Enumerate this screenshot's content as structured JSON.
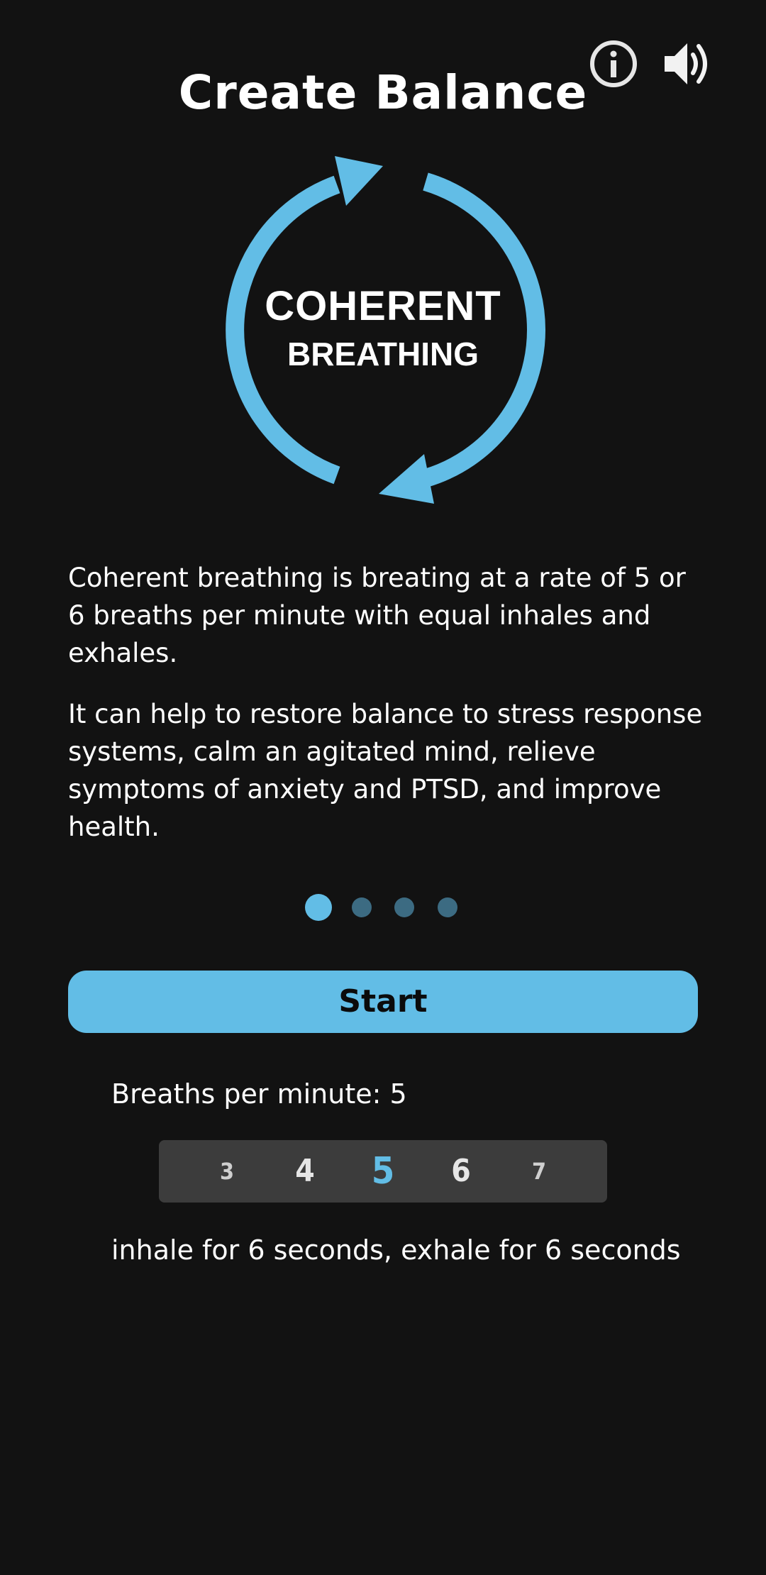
{
  "header": {
    "title": "Create Balance",
    "info_icon": "info-icon",
    "sound_icon": "speaker-volume-icon"
  },
  "logo": {
    "line1": "COHERENT",
    "line2": "BREATHING",
    "arrow_color": "#62bde6",
    "icon": "circular-arrows-icon"
  },
  "description": {
    "paragraph1": "Coherent breathing is breating at a rate of 5 or 6 breaths per minute with equal inhales and exhales.",
    "paragraph2": "It can help to restore balance to stress response systems, calm an agitated mind, relieve symptoms of anxiety and PTSD, and improve health."
  },
  "pager": {
    "total": 4,
    "active_index": 0
  },
  "start_button": {
    "label": "Start"
  },
  "breaths": {
    "label": "Breaths per minute: 5",
    "options": [
      "3",
      "4",
      "5",
      "6",
      "7"
    ],
    "selected": "5"
  },
  "timing_text": "inhale for 6 seconds, exhale for 6 seconds",
  "colors": {
    "background": "#121212",
    "accent": "#62bde6",
    "dot_inactive": "#3c6b82",
    "picker_bg": "#3c3c3c"
  }
}
